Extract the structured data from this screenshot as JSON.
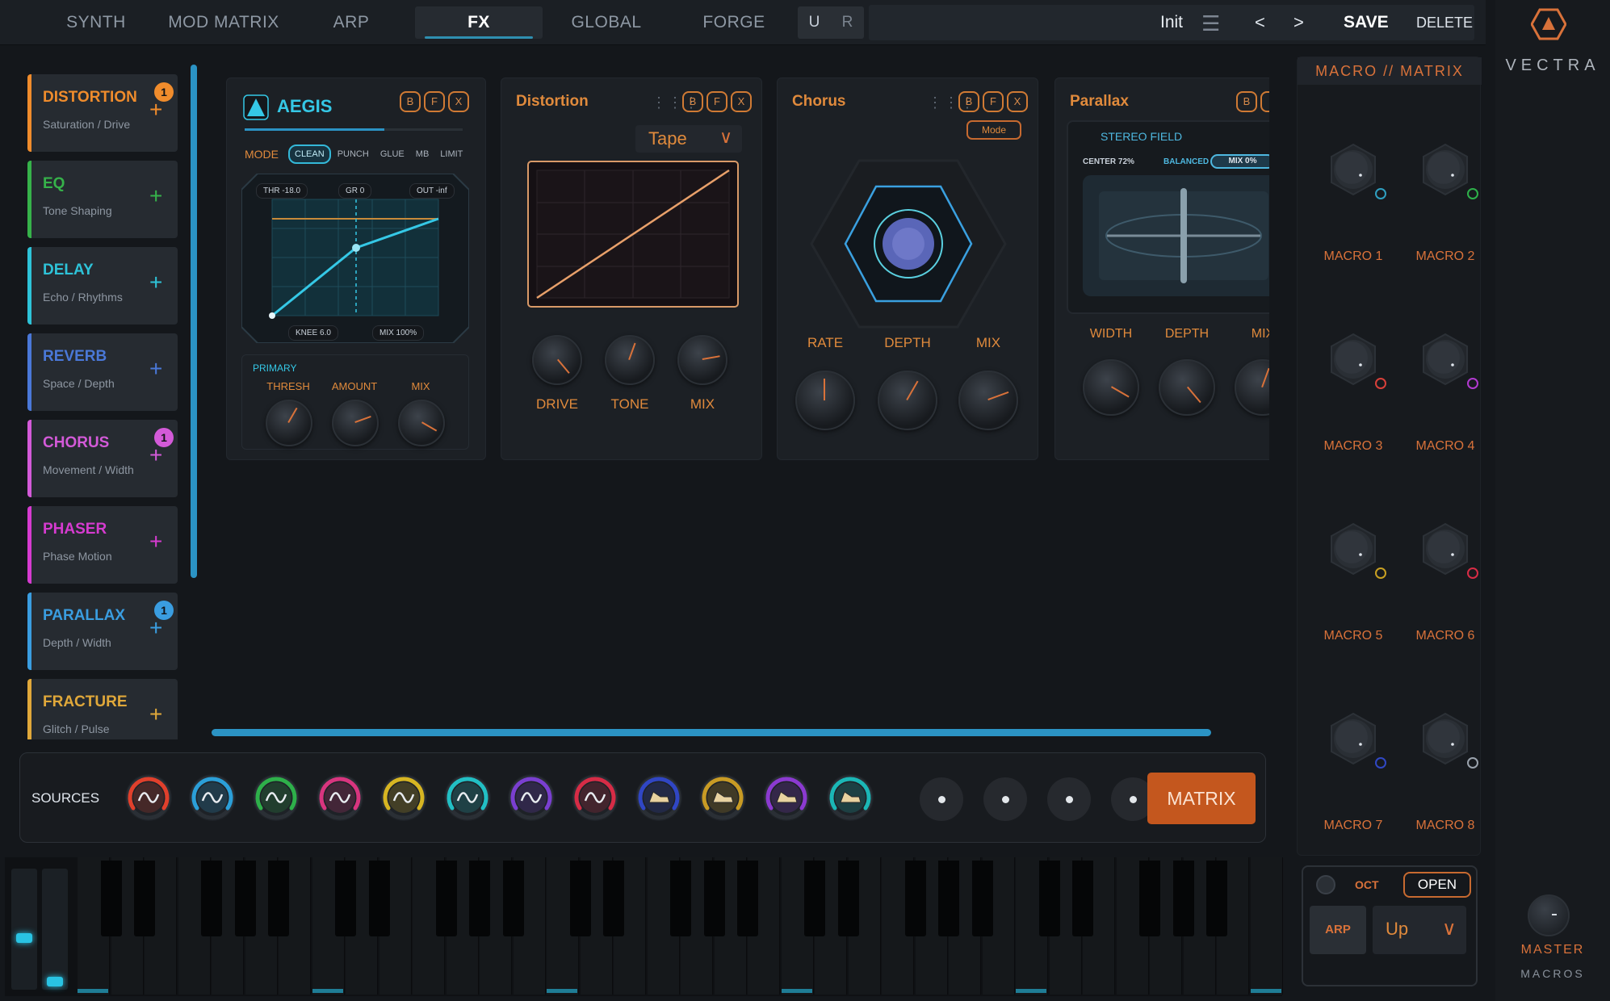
{
  "tabs": [
    "SYNTH",
    "MOD MATRIX",
    "ARP",
    "FX",
    "GLOBAL",
    "FORGE"
  ],
  "active_tab": "FX",
  "undo_redo": {
    "undo": "U",
    "redo": "R"
  },
  "preset": {
    "name": "Init",
    "menu": "☰",
    "prev": "<",
    "next": ">",
    "save": "SAVE",
    "delete": "DELETE"
  },
  "brand": "VECTRA",
  "effects": [
    {
      "title": "DISTORTION",
      "subtitle": "Saturation / Drive",
      "color": "#f08c2c",
      "badge": "1"
    },
    {
      "title": "EQ",
      "subtitle": "Tone Shaping",
      "color": "#36b24a",
      "badge": ""
    },
    {
      "title": "DELAY",
      "subtitle": "Echo / Rhythms",
      "color": "#2ec3d8",
      "badge": ""
    },
    {
      "title": "REVERB",
      "subtitle": "Space / Depth",
      "color": "#4a78d8",
      "badge": ""
    },
    {
      "title": "CHORUS",
      "subtitle": "Movement / Width",
      "color": "#d35ad8",
      "badge": "1"
    },
    {
      "title": "PHASER",
      "subtitle": "Phase Motion",
      "color": "#d63bd0",
      "badge": ""
    },
    {
      "title": "PARALLAX",
      "subtitle": "Depth / Width",
      "color": "#3a9de0",
      "badge": "1"
    },
    {
      "title": "FRACTURE",
      "subtitle": "Glitch / Pulse",
      "color": "#e0a83a",
      "badge": ""
    }
  ],
  "aegis": {
    "title": "AEGIS",
    "buttons": [
      "B",
      "F",
      "X"
    ],
    "mode_label": "MODE",
    "modes": [
      "CLEAN",
      "PUNCH",
      "GLUE",
      "MB",
      "LIMIT"
    ],
    "active_mode": "CLEAN",
    "readouts": {
      "thr": "THR -18.0",
      "gr": "GR 0",
      "out": "OUT -inf",
      "knee": "KNEE 6.0",
      "mix": "MIX 100%"
    },
    "section": "PRIMARY",
    "knobs": [
      "THRESH",
      "AMOUNT",
      "MIX"
    ]
  },
  "distortion": {
    "title": "Distortion",
    "buttons": [
      "B",
      "F",
      "X"
    ],
    "type": "Tape",
    "knobs": [
      "DRIVE",
      "TONE",
      "MIX"
    ]
  },
  "chorus": {
    "title": "Chorus",
    "buttons": [
      "B",
      "F",
      "X"
    ],
    "mode_button": "Mode",
    "knobs": [
      "RATE",
      "DEPTH",
      "MIX"
    ]
  },
  "parallax": {
    "title": "Parallax",
    "buttons": [
      "B"
    ],
    "stereo_field": "STEREO FIELD",
    "center": "CENTER 72%",
    "balanced": "BALANCED",
    "mix": "MIX 0%",
    "knobs": [
      "WIDTH",
      "DEPTH",
      "MIX"
    ]
  },
  "sources": {
    "label": "SOURCES",
    "items": [
      {
        "color": "#e0402c",
        "type": "lfo"
      },
      {
        "color": "#2b9fd8",
        "type": "lfo"
      },
      {
        "color": "#2eb04a",
        "type": "lfo"
      },
      {
        "color": "#d8357f",
        "type": "lfo"
      },
      {
        "color": "#d6b522",
        "type": "lfo"
      },
      {
        "color": "#22bfc4",
        "type": "lfo"
      },
      {
        "color": "#7a3fd0",
        "type": "lfo"
      },
      {
        "color": "#d62c46",
        "type": "lfo"
      },
      {
        "color": "#3046c4",
        "type": "env"
      },
      {
        "color": "#c89b24",
        "type": "env"
      },
      {
        "color": "#8b3ad0",
        "type": "env"
      },
      {
        "color": "#1bb7b6",
        "type": "env"
      }
    ],
    "empty_slots": 4,
    "matrix_button": "MATRIX"
  },
  "macro_panel": {
    "title": "MACRO // MATRIX",
    "macros": [
      {
        "label": "MACRO 1",
        "led": "#2f9fc0"
      },
      {
        "label": "MACRO 2",
        "led": "#2eb04a"
      },
      {
        "label": "MACRO 3",
        "led": "#d8403a"
      },
      {
        "label": "MACRO 4",
        "led": "#b23ad0"
      },
      {
        "label": "MACRO 5",
        "led": "#c8a022"
      },
      {
        "label": "MACRO 6",
        "led": "#d82c46"
      },
      {
        "label": "MACRO 7",
        "led": "#3048c4"
      },
      {
        "label": "MACRO 8",
        "led": "#9aa2ac"
      }
    ]
  },
  "arp_box": {
    "oct": "OCT",
    "open": "OPEN",
    "arp": "ARP",
    "mode": "Up",
    "chevron": "∨"
  },
  "master": {
    "label": "MASTER",
    "macros": "MACROS"
  }
}
